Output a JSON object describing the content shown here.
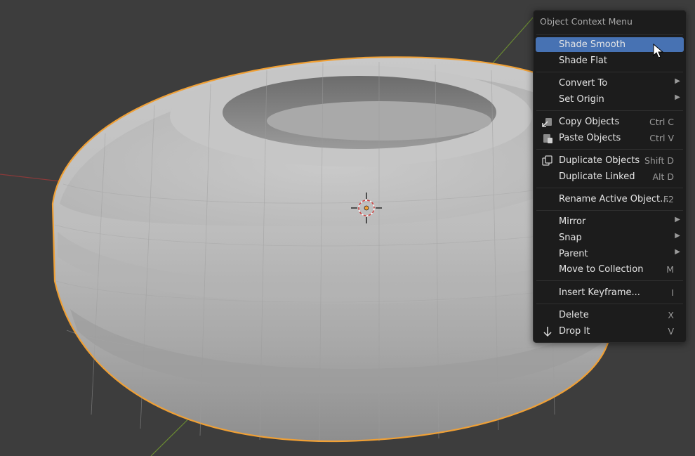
{
  "menu": {
    "title": "Object Context Menu",
    "items": [
      {
        "label": "Shade Smooth",
        "shortcut": "",
        "submenu": false,
        "icon": "",
        "highlighted": true
      },
      {
        "label": "Shade Flat",
        "shortcut": "",
        "submenu": false,
        "icon": ""
      },
      {
        "label": "Convert To",
        "shortcut": "",
        "submenu": true,
        "icon": ""
      },
      {
        "label": "Set Origin",
        "shortcut": "",
        "submenu": true,
        "icon": ""
      },
      {
        "label": "Copy Objects",
        "shortcut": "Ctrl C",
        "submenu": false,
        "icon": "copy-icon"
      },
      {
        "label": "Paste Objects",
        "shortcut": "Ctrl V",
        "submenu": false,
        "icon": "paste-icon"
      },
      {
        "label": "Duplicate Objects",
        "shortcut": "Shift D",
        "submenu": false,
        "icon": "duplicate-icon"
      },
      {
        "label": "Duplicate Linked",
        "shortcut": "Alt D",
        "submenu": false,
        "icon": ""
      },
      {
        "label": "Rename Active Object...",
        "shortcut": "F2",
        "submenu": false,
        "icon": ""
      },
      {
        "label": "Mirror",
        "shortcut": "",
        "submenu": true,
        "icon": ""
      },
      {
        "label": "Snap",
        "shortcut": "",
        "submenu": true,
        "icon": ""
      },
      {
        "label": "Parent",
        "shortcut": "",
        "submenu": true,
        "icon": ""
      },
      {
        "label": "Move to Collection",
        "shortcut": "M",
        "submenu": false,
        "icon": ""
      },
      {
        "label": "Insert Keyframe...",
        "shortcut": "I",
        "submenu": false,
        "icon": ""
      },
      {
        "label": "Delete",
        "shortcut": "X",
        "submenu": false,
        "icon": ""
      },
      {
        "label": "Drop It",
        "shortcut": "V",
        "submenu": false,
        "icon": "drop-arrow-icon"
      }
    ]
  },
  "colors": {
    "background": "#3d3d3d",
    "menu_bg": "#1c1c1c",
    "highlight": "#4772b3",
    "selection_outline": "#f0a035",
    "x_axis": "#8a3a3a",
    "y_axis": "#6a8a32"
  }
}
